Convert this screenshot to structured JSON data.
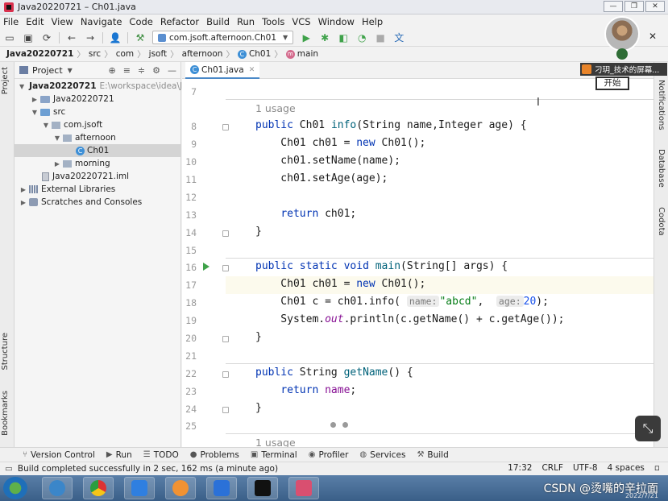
{
  "window": {
    "title": "Java20220721 – Ch01.java",
    "buttons": [
      "—",
      "❐",
      "✕"
    ]
  },
  "menu": [
    "File",
    "Edit",
    "View",
    "Navigate",
    "Code",
    "Refactor",
    "Build",
    "Run",
    "Tools",
    "VCS",
    "Window",
    "Help"
  ],
  "toolbar": {
    "run_config": "com.jsoft.afternoon.Ch01"
  },
  "breadcrumb": [
    "Java20220721",
    "src",
    "com",
    "jsoft",
    "afternoon",
    "Ch01",
    "main"
  ],
  "project_panel": {
    "title": "Project",
    "tree": [
      {
        "label": "Java20220721",
        "path": "E:\\workspace\\idea\\Ja",
        "level": 0
      },
      {
        "label": "Java20220721",
        "level": 1
      },
      {
        "label": "src",
        "level": 1
      },
      {
        "label": "com.jsoft",
        "level": 2
      },
      {
        "label": "afternoon",
        "level": 3
      },
      {
        "label": "Ch01",
        "level": 4
      },
      {
        "label": "morning",
        "level": 3
      },
      {
        "label": "Java20220721.iml",
        "level": 1
      },
      {
        "label": "External Libraries",
        "level": 0
      },
      {
        "label": "Scratches and Consoles",
        "level": 0
      }
    ]
  },
  "left_strip": [
    "Project",
    "Structure",
    "Bookmarks"
  ],
  "right_strip": [
    "Notifications",
    "Database",
    "Codota"
  ],
  "editor": {
    "tab": "Ch01.java",
    "usage": "1 usage",
    "line_numbers": [
      "7",
      "8",
      "9",
      "10",
      "11",
      "12",
      "13",
      "14",
      "15",
      "16",
      "17",
      "18",
      "19",
      "20",
      "21",
      "22",
      "23",
      "24",
      "25"
    ],
    "hint_name": "name:",
    "hint_age": "age:",
    "string_literal": "\"abcd\"",
    "number_literal": "20"
  },
  "tool_windows": [
    "Version Control",
    "Run",
    "TODO",
    "Problems",
    "Terminal",
    "Profiler",
    "Services",
    "Build"
  ],
  "status": {
    "message": "Build completed successfully in 2 sec, 162 ms (a minute ago)",
    "position": "17:32",
    "line_sep": "CRLF",
    "encoding": "UTF-8",
    "indent": "4 spaces"
  },
  "overlay": {
    "share_title": "刁玥_技术的屏幕...",
    "start_button": "开始"
  },
  "watermark": {
    "text": "CSDN @烫嘴的辛拉面",
    "date": "2022/7/21"
  }
}
